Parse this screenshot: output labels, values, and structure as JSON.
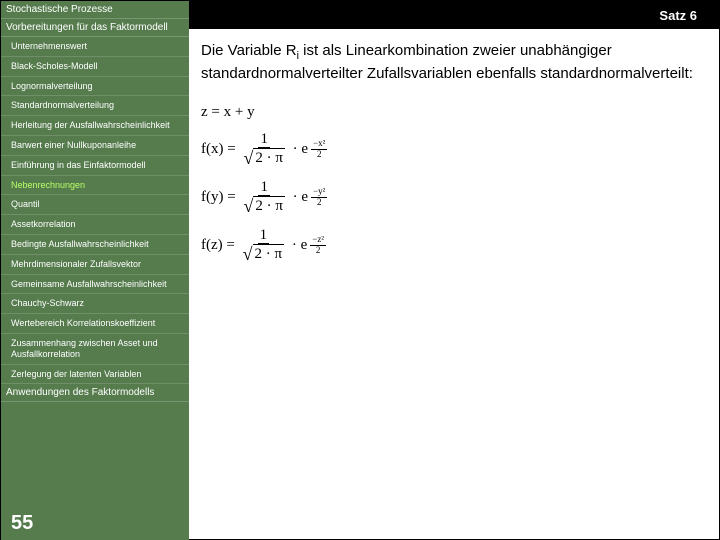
{
  "header": {
    "title": "Satz 6"
  },
  "sidebar": {
    "section0": "Stochastische Prozesse",
    "section1": "Vorbereitungen für das Faktormodell",
    "items": [
      "Unternehmenswert",
      "Black-Scholes-Modell",
      "Lognormalverteilung",
      "Standardnormalverteilung",
      "Herleitung der Ausfallwahrscheinlichkeit",
      "Barwert einer Nullkuponanleihe",
      "Einführung in das Einfaktormodell"
    ],
    "highlight": "Nebenrechnungen",
    "items2": [
      "Quantil",
      "Assetkorrelation",
      "Bedingte Ausfallwahrscheinlichkeit",
      "Mehrdimensionaler Zufallsvektor",
      "Gemeinsame Ausfallwahrscheinlichkeit",
      "Chauchy-Schwarz",
      "Wertebereich Korrelationskoeffizient",
      "Zusammenhang zwischen Asset und Ausfallkorrelation",
      "Zerlegung der latenten Variablen"
    ],
    "section2": "Anwendungen des Faktormodells"
  },
  "para": {
    "t1": "Die Variable R",
    "sub": "i",
    "t2": " ist als Linearkombination zweier unabhängiger standardnormalverteilter Zufallsvariablen ebenfalls standardnormalverteilt:"
  },
  "eq": {
    "line1": "z = x + y",
    "fx": "f(x) =",
    "fy": "f(y) =",
    "fz": "f(z) =",
    "one": "1",
    "twopi": "2 · π",
    "dot_e": "· e",
    "minus": "−",
    "x2": "x²",
    "y2": "y²",
    "z2": "z²",
    "two": "2"
  },
  "page": "55"
}
